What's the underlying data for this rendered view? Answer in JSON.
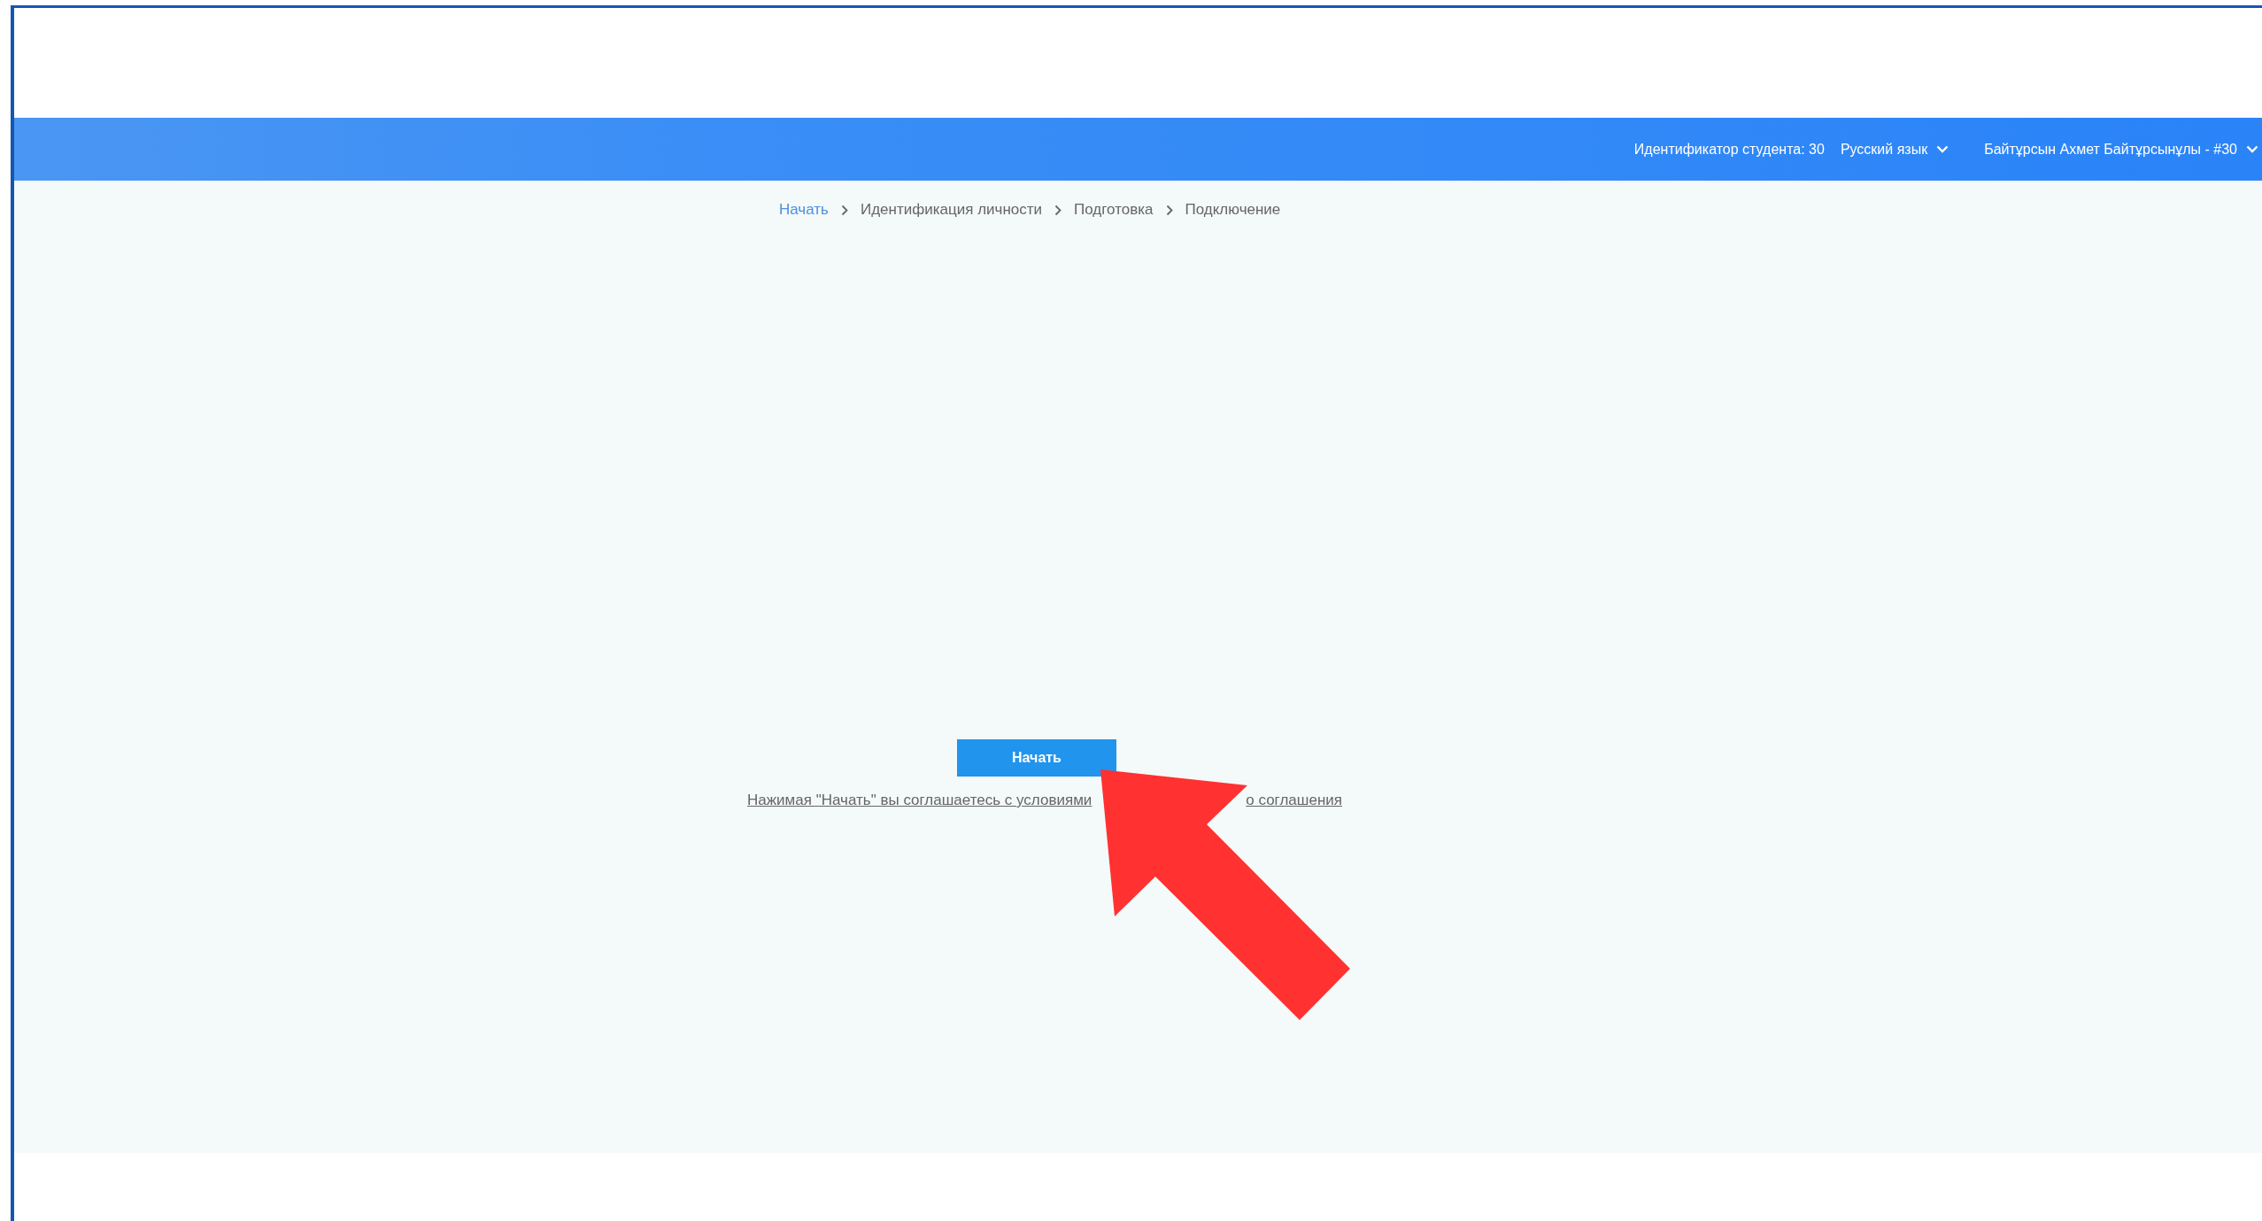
{
  "header": {
    "student_id": "Идентификатор студента: 30",
    "language": "Русский язык",
    "user": "Байтұрсын Ахмет Байтұрсынұлы - #30"
  },
  "breadcrumbs": [
    {
      "label": "Начать",
      "link": true
    },
    {
      "label": "Идентификация личности",
      "link": false
    },
    {
      "label": "Подготовка",
      "link": false
    },
    {
      "label": "Подключение",
      "link": false
    }
  ],
  "start_button": "Начать",
  "terms_link": [
    "Нажимая \"Начать\" вы соглашаетесь с условиями",
    "о соглашения"
  ]
}
